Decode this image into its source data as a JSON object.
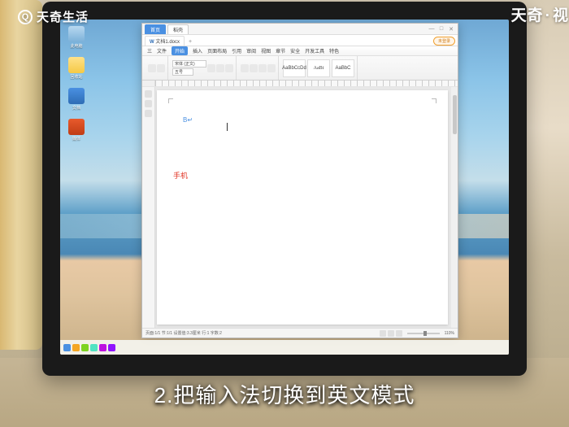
{
  "watermark": {
    "left_icon": "Q",
    "left_text": "天奇生活",
    "right_prefix": "天奇",
    "right_dot": "·",
    "right_suffix": "视"
  },
  "subtitle": "2.把输入法切换到英文模式",
  "desktop_icons": [
    {
      "label": "此电脑"
    },
    {
      "label": "回收站"
    },
    {
      "label": "文档"
    },
    {
      "label": "媒体"
    }
  ],
  "wps": {
    "home_tab": "首页",
    "other_tab": "稻壳",
    "doc_tab": "文档1.docx",
    "plus": "+",
    "login_pill": "未登录",
    "menus": [
      "三",
      "文件",
      "开始",
      "插入",
      "页面布局",
      "引用",
      "审阅",
      "视图",
      "章节",
      "安全",
      "开发工具",
      "特色"
    ],
    "font_name": "宋体 (正文)",
    "font_size": "五号",
    "style1": "AaBbCcDd",
    "style2": "AaBt",
    "style3": "AaBbC",
    "cursor_mark": "B↵",
    "red_text": "手机",
    "status_left": "页面:1/1  节:1/1  设置值:3.3厘米  行:1  字数:2",
    "zoom": "110%"
  },
  "window_controls": {
    "min": "—",
    "max": "□",
    "close": "✕"
  }
}
